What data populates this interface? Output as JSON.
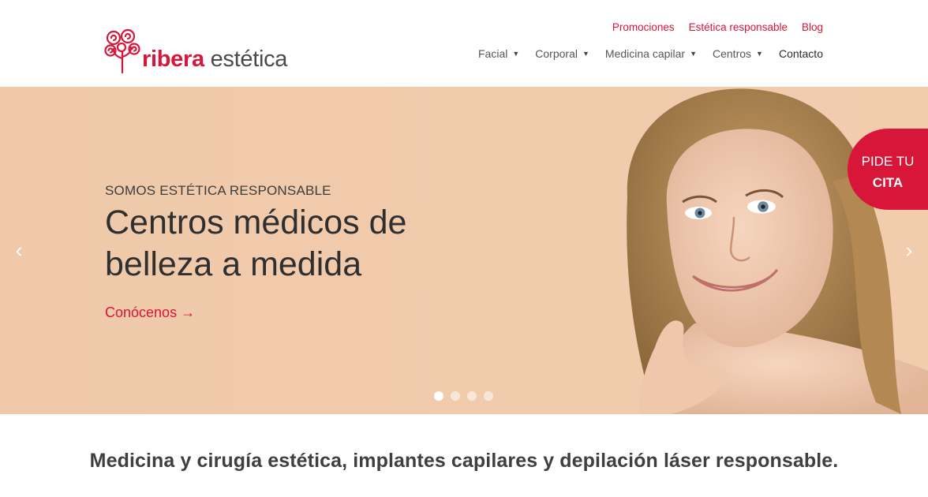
{
  "brand": {
    "name_strong": "ribera",
    "name_light": "estética",
    "accent": "#d7163a"
  },
  "topnav": [
    {
      "label": "Promociones"
    },
    {
      "label": "Estética responsable"
    },
    {
      "label": "Blog"
    }
  ],
  "mainnav": [
    {
      "label": "Facial",
      "dropdown": true
    },
    {
      "label": "Corporal",
      "dropdown": true
    },
    {
      "label": "Medicina capilar",
      "dropdown": true
    },
    {
      "label": "Centros",
      "dropdown": true
    },
    {
      "label": "Contacto",
      "dropdown": false
    }
  ],
  "hero": {
    "eyebrow": "SOMOS ESTÉTICA RESPONSABLE",
    "headline": "Centros médicos de belleza a medida",
    "cta": "Conócenos →",
    "slides_total": 4,
    "active_slide": 1,
    "background": "#f0cbac"
  },
  "icons": {
    "prev": "chevron-left-icon",
    "next": "chevron-right-icon",
    "caret": "caret-down-icon"
  },
  "badge": {
    "line1": "PIDE TU",
    "line2": "CITA"
  },
  "tagline": "Medicina y cirugía estética, implantes capilares y depilación láser responsable."
}
